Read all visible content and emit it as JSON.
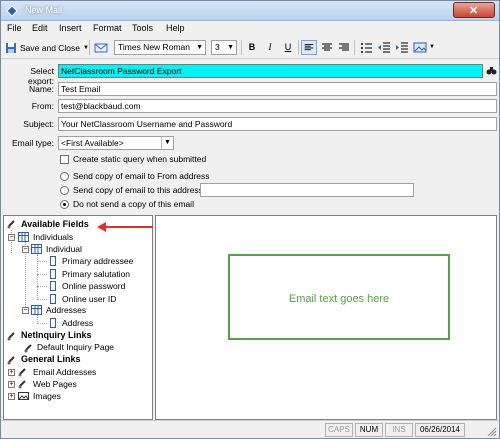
{
  "window": {
    "title": "New Mail",
    "close_glyph": "✕"
  },
  "menu": [
    "File",
    "Edit",
    "Insert",
    "Format",
    "Tools",
    "Help"
  ],
  "toolbar": {
    "save_label": "Save and Close",
    "font": "Times New Roman",
    "size": "3",
    "bold": "B",
    "italic": "I",
    "underline": "U"
  },
  "form": {
    "select_export_label": "Select export:",
    "select_export_value": "NetClassroom Password Export",
    "name_label": "Name:",
    "name_value": "Test Email",
    "from_label": "From:",
    "from_value": "test@blackbaud.com",
    "subject_label": "Subject:",
    "subject_value": "Your NetClassroom Username and Password",
    "email_type_label": "Email type:",
    "email_type_value": "<First Available>",
    "static_query_label": "Create static query when submitted",
    "send_from_label": "Send copy of email to From address",
    "send_this_label": "Send copy of email to this address:",
    "no_copy_label": "Do not send a copy of this email",
    "selected_radio": "no_copy"
  },
  "tree": {
    "available_fields": "Available Fields",
    "individuals": "Individuals",
    "individual": "Individual",
    "fields": [
      "Primary addressee",
      "Primary salutation",
      "Online password",
      "Online user ID"
    ],
    "addresses": "Addresses",
    "address": "Address",
    "netinquiry_links": "NetInquiry Links",
    "default_inquiry": "Default Inquiry Page",
    "general_links": "General Links",
    "email_addresses": "Email Addresses",
    "web_pages": "Web Pages",
    "images": "Images"
  },
  "editor": {
    "placeholder": "Email text goes here"
  },
  "status": {
    "caps": "CAPS",
    "num": "NUM",
    "ins": "INS",
    "date": "06/26/2014"
  },
  "colors": {
    "export_field": "#00f3f5",
    "annotation_arrow": "#d9322a",
    "annotation_box": "#5aa04a"
  }
}
